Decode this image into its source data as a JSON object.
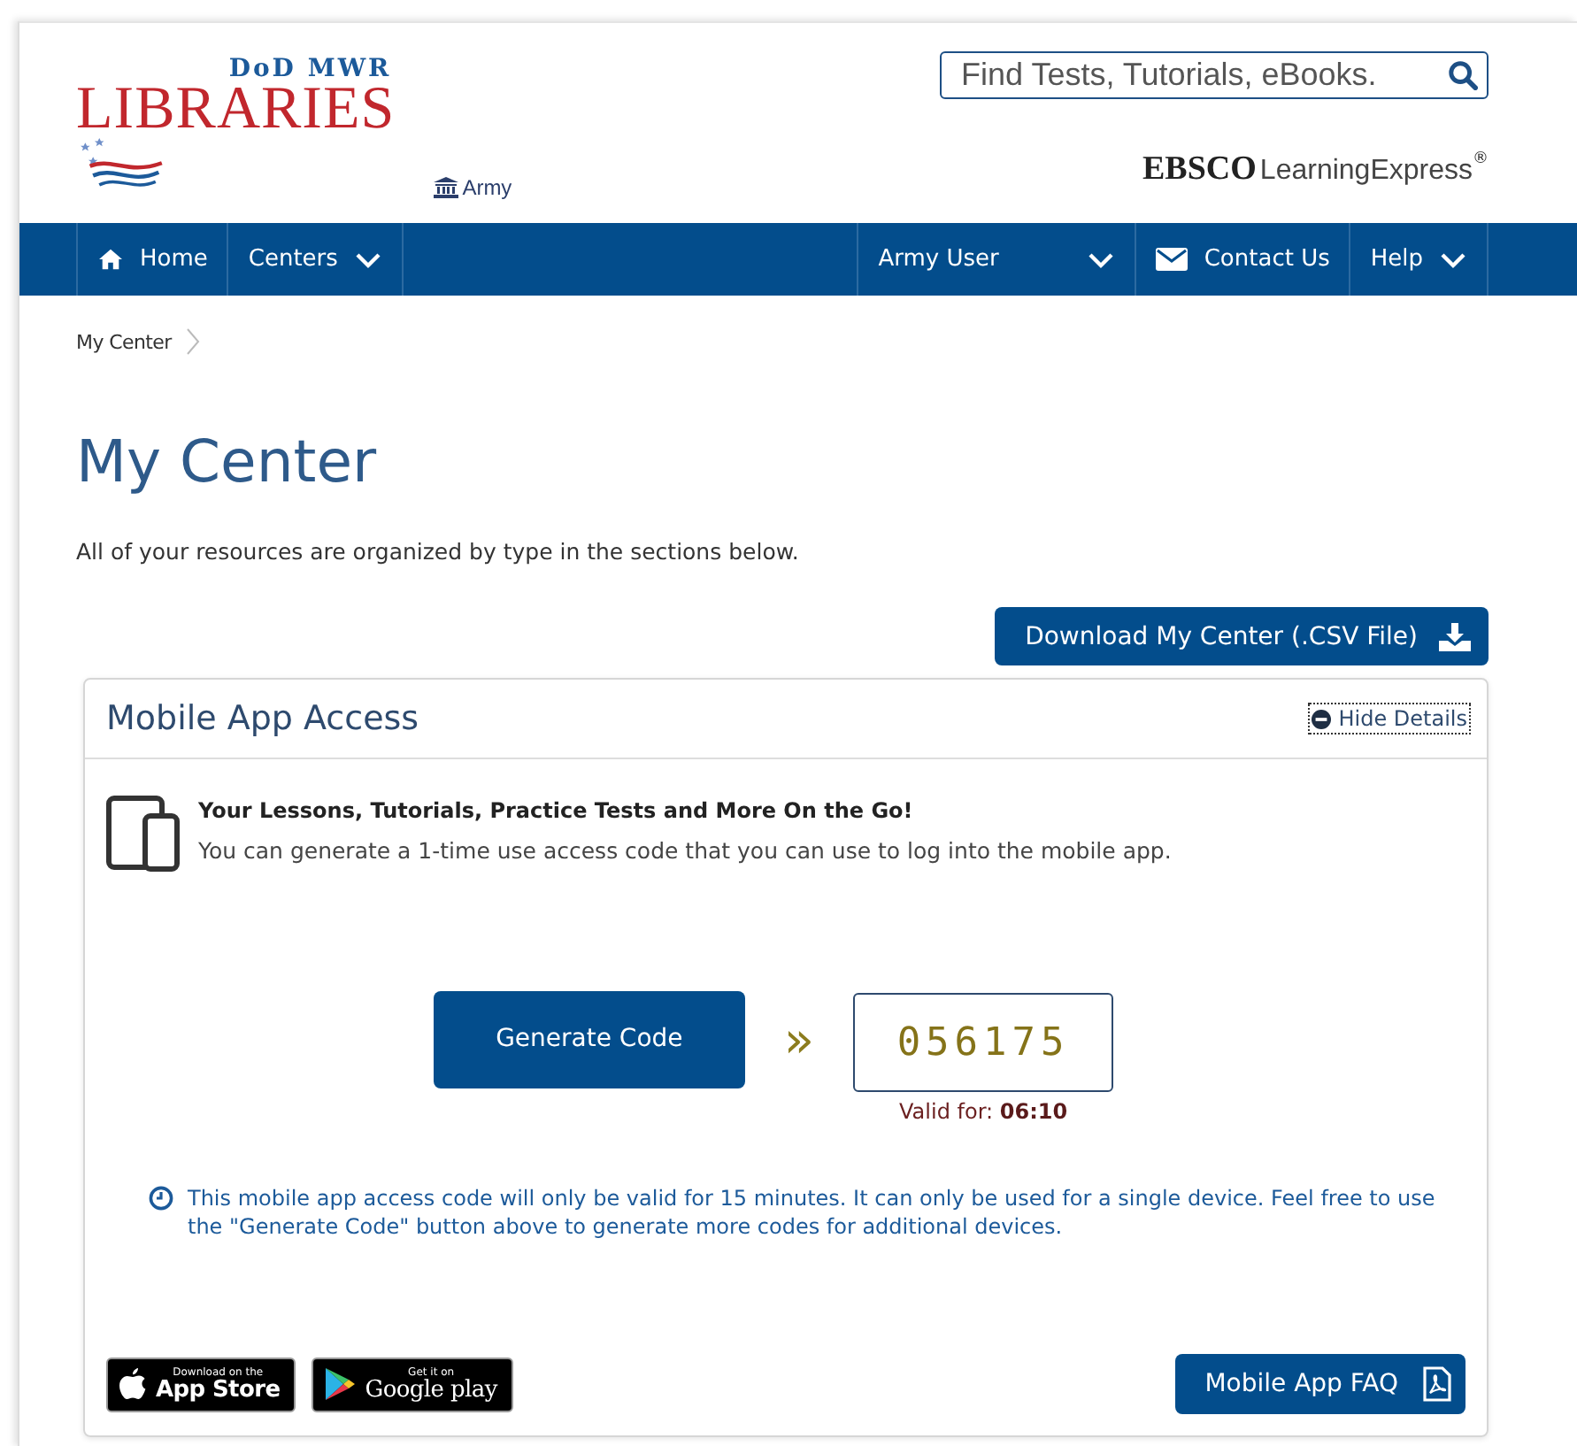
{
  "header": {
    "logo": {
      "top": "DoD MWR",
      "main": "LIBRARIES"
    },
    "branch": "Army",
    "search": {
      "placeholder": "Find Tests, Tutorials, eBooks."
    },
    "vendor": {
      "brand": "EBSCO",
      "product": "LearningExpress",
      "mark": "®"
    }
  },
  "nav": {
    "left": [
      {
        "label": "Home",
        "kind": "home"
      },
      {
        "label": "Centers",
        "kind": "dropdown"
      }
    ],
    "right": [
      {
        "label": "Army User",
        "kind": "dropdown"
      },
      {
        "label": "Contact Us",
        "kind": "mail"
      },
      {
        "label": "Help",
        "kind": "dropdown"
      }
    ]
  },
  "breadcrumb": [
    "My Center"
  ],
  "page": {
    "title": "My Center",
    "intro": "All of your resources are organized by type in the sections below.",
    "download_button": "Download My Center (.CSV File)"
  },
  "panel": {
    "title": "Mobile App Access",
    "toggle": "Hide Details",
    "heading": "Your Lessons, Tutorials, Practice Tests and More On the Go!",
    "description": "You can generate a 1-time use access code that you can use to log into the mobile app.",
    "generate_button": "Generate Code",
    "arrow": "»",
    "code": "056175",
    "valid_label": "Valid for:",
    "valid_time": "06:10",
    "notice": "This mobile app access code will only be valid for 15 minutes. It can only be used for a single device. Feel free to use the \"Generate Code\" button above to generate more codes for additional devices.",
    "stores": [
      {
        "kind": "apple",
        "small": "Download on the",
        "big": "App Store"
      },
      {
        "kind": "google",
        "small": "Get it on",
        "big": "Google play"
      }
    ],
    "faq_button": "Mobile App FAQ"
  }
}
